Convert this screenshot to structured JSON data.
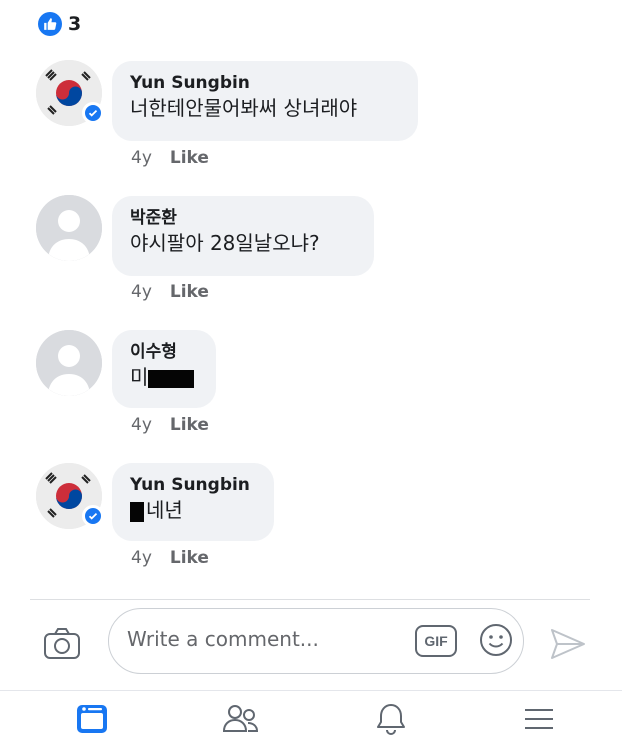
{
  "reactions": {
    "icon": "like-icon",
    "count": "3",
    "color": "#1877f2"
  },
  "comments": [
    {
      "author": "Yun Sungbin",
      "text": "너한테안물어봐써 상녀래야",
      "time": "4y",
      "like_label": "Like",
      "avatar": "korean-flag-avatar",
      "verified": true
    },
    {
      "author": "박준환",
      "text": "야시팔아 28일날오냐?",
      "time": "4y",
      "like_label": "Like",
      "avatar": "default-avatar",
      "verified": false
    },
    {
      "author": "이수형",
      "text_visible": "미",
      "text_redacted": true,
      "time": "4y",
      "like_label": "Like",
      "avatar": "default-avatar",
      "verified": false
    },
    {
      "author": "Yun Sungbin",
      "text_visible": "네년",
      "text_redacted": true,
      "time": "4y",
      "like_label": "Like",
      "avatar": "korean-flag-avatar",
      "verified": true
    }
  ],
  "composer": {
    "placeholder": "Write a comment...",
    "gif_label": "GIF"
  },
  "tabbar": {
    "items": [
      "feed-icon",
      "friends-icon",
      "notifications-icon",
      "menu-icon"
    ],
    "active": "feed-icon",
    "accent": "#1877f2"
  }
}
